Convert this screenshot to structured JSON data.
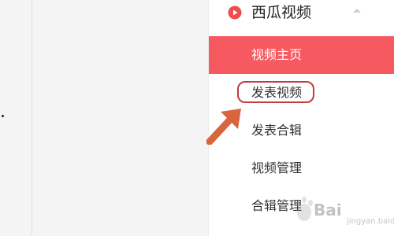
{
  "sidebar": {
    "section": {
      "icon": "play-circle-icon",
      "title": "西瓜视频",
      "collapse_icon": "chevron-up-icon"
    },
    "items": [
      {
        "label": "视频主页",
        "active": true
      },
      {
        "label": "发表视频",
        "active": false
      },
      {
        "label": "发表合辑",
        "active": false
      },
      {
        "label": "视频管理",
        "active": false
      },
      {
        "label": "合辑管理",
        "active": false
      }
    ]
  },
  "annotation": {
    "highlight_color": "#c53a3c",
    "arrow_color": "#d9653f"
  },
  "watermark": {
    "brand": "Bai",
    "sub": "jingyan.baidu.com"
  },
  "colors": {
    "accent": "#f6595f",
    "icon_red": "#f04e4e"
  }
}
